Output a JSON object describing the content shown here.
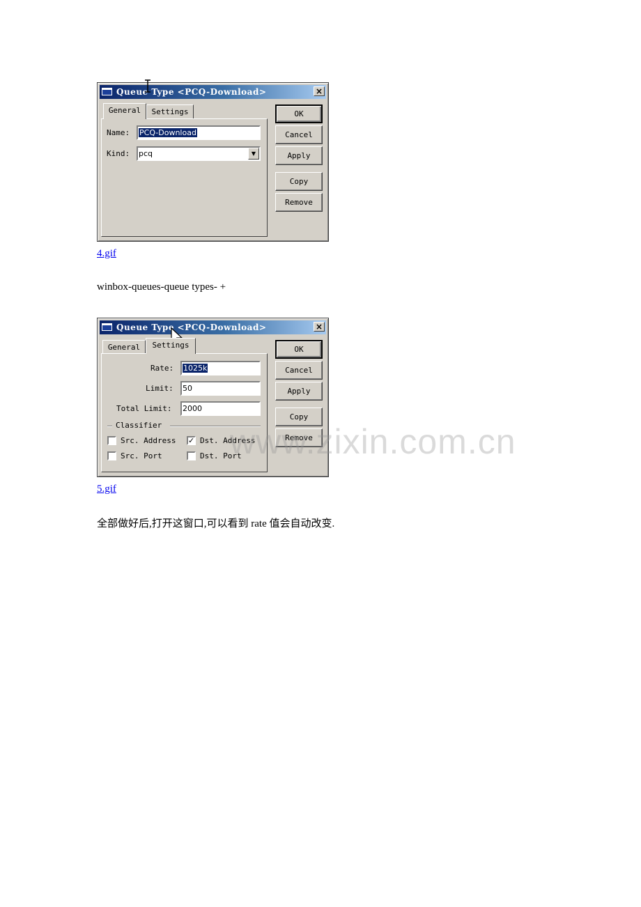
{
  "dialog1": {
    "title": "Queue Type <PCQ-Download>",
    "close_glyph": "×",
    "tabs": {
      "general": "General",
      "settings": "Settings"
    },
    "name_label": "Name:",
    "name_value": "PCQ-Download",
    "kind_label": "Kind:",
    "kind_value": "pcq",
    "buttons": {
      "ok": "OK",
      "cancel": "Cancel",
      "apply": "Apply",
      "copy": "Copy",
      "remove": "Remove"
    }
  },
  "caption1": "4.gif",
  "instruction": "winbox-queues-queue types- +",
  "dialog2": {
    "title": "Queue Type <PCQ-Download>",
    "close_glyph": "×",
    "tabs": {
      "general": "General",
      "settings": "Settings"
    },
    "rate_label": "Rate:",
    "rate_value": "1025k",
    "limit_label": "Limit:",
    "limit_value": "50",
    "total_limit_label": "Total Limit:",
    "total_limit_value": "2000",
    "classifier_label": "Classifier",
    "checkboxes": {
      "src_address": {
        "label": "Src. Address",
        "checked": false
      },
      "dst_address": {
        "label": "Dst. Address",
        "checked": true
      },
      "src_port": {
        "label": "Src. Port",
        "checked": false
      },
      "dst_port": {
        "label": "Dst. Port",
        "checked": false
      }
    },
    "check_glyph": "✓",
    "buttons": {
      "ok": "OK",
      "cancel": "Cancel",
      "apply": "Apply",
      "copy": "Copy",
      "remove": "Remove"
    }
  },
  "caption2": "5.gif",
  "closing_text": "全部做好后,打开这窗口,可以看到 rate 值会自动改变.",
  "watermark": "www.zixin.com.cn"
}
